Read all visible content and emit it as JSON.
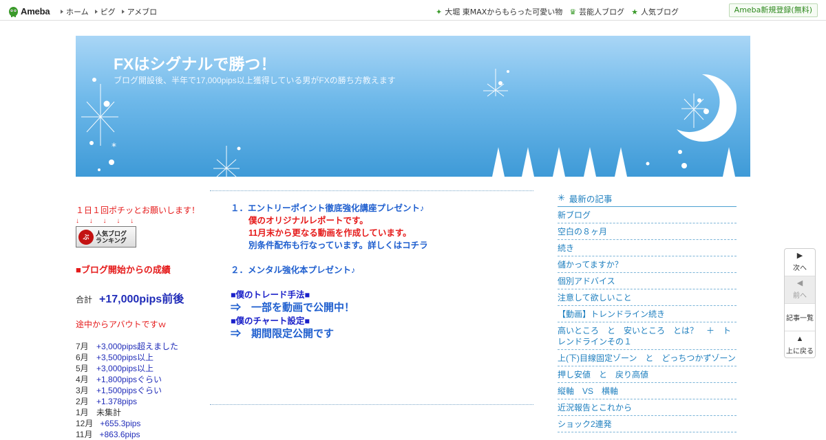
{
  "topbar": {
    "logo_text": "Ameba",
    "nav": [
      "ホーム",
      "ピグ",
      "アメブロ"
    ],
    "right_links": [
      {
        "icon": "sparkle-icon",
        "glyph": "✦",
        "label": "大堀 東MAXからもらった可愛い物"
      },
      {
        "icon": "crown-icon",
        "glyph": "♛",
        "label": "芸能人ブログ"
      },
      {
        "icon": "star-icon",
        "glyph": "★",
        "label": "人気ブログ"
      }
    ],
    "register_label": "Ameba新規登録(無料)"
  },
  "header": {
    "title": "FXはシグナルで勝つ！",
    "description": "ブログ開設後、半年で17,000pips以上獲得している男がFXの勝ち方教えます"
  },
  "left": {
    "request_text": "１日１回ポチッとお願いします！",
    "arrows": "↓ ↓ ↓ ↓ ↓",
    "ranking_banner": {
      "circle": "ぶ",
      "line1": "人気ブログ",
      "line2": "ランキング"
    },
    "achievement_heading": "■ブログ開始からの成績",
    "total_label": "合計",
    "total_value": "+17,000pips前後",
    "note": "途中からアバウトですｗ",
    "months": [
      {
        "month": "7月",
        "value": "+3,000pips超えました"
      },
      {
        "month": "6月",
        "value": "+3,500pips以上"
      },
      {
        "month": "5月",
        "value": "+3,000pips以上"
      },
      {
        "month": "4月",
        "value": "+1,800pipsぐらい"
      },
      {
        "month": "3月",
        "value": "+1,500pipsぐらい"
      },
      {
        "month": "2月",
        "value": "+1.378pips"
      },
      {
        "month": "1月",
        "value": "未集計"
      },
      {
        "month": "12月",
        "value": "+655.3pips"
      },
      {
        "month": "11月",
        "value": "+863.6pips"
      }
    ]
  },
  "entry": {
    "item1_title": "１．エントリーポイント徹底強化講座プレゼント♪",
    "item1_line1": "僕のオリジナルレポートです。",
    "item1_line2": "11月末から更なる動画を作成しています。",
    "item1_line3": "別条件配布も行なっています。詳しくはコチラ",
    "item2_title": "２．メンタル強化本プレゼント♪",
    "trade_heading": "■僕のトレード手法■",
    "trade_text": "⇒　一部を動画で公開中！",
    "chart_heading": "■僕のチャート設定■",
    "chart_text": "⇒　期間限定公開です"
  },
  "sidebar": {
    "heading": "最新の記事",
    "posts": [
      "新ブログ",
      "空白の８ヶ月",
      "続き",
      "儲かってますか？",
      "個別アドバイス",
      "注意して欲しいこと",
      "【動画】トレンドライン続き",
      "高いところ　と　安いところ　とは？　＋　トレンドラインその１",
      "上(下)目線固定ゾーン　と　どっちつかずゾーン",
      "押し安値　と　戻り高値",
      "縦軸　VS　横軸",
      "近況報告とこれから",
      "ショック2連発"
    ]
  },
  "floatnav": {
    "next": "次へ",
    "prev": "前へ",
    "list": "記事一覧",
    "top": "上に戻る"
  }
}
